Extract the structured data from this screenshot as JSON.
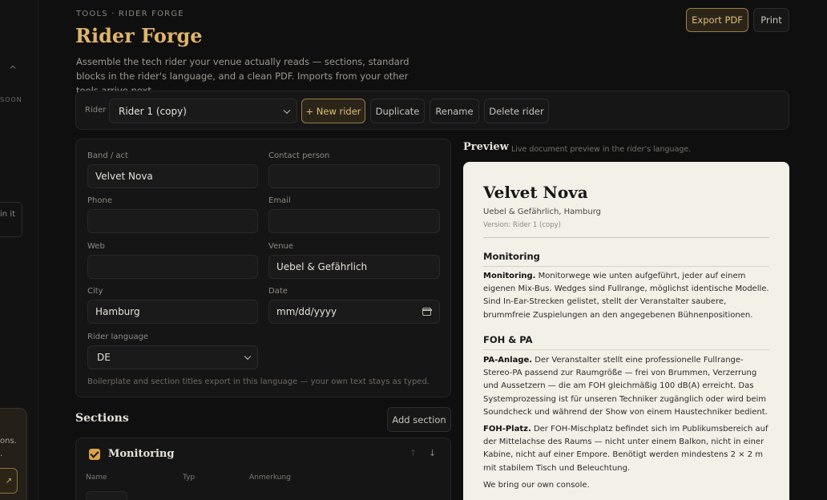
{
  "sidebar": {
    "soon_label": "SOON",
    "join_label": "in it",
    "card_text_1": "ons.",
    "card_text_2": ".",
    "arrow_glyph": "↗"
  },
  "header": {
    "breadcrumb": "TOOLS · RIDER FORGE",
    "title": "Rider Forge",
    "description": "Assemble the tech rider your venue actually reads — sections, standard blocks in the rider's language, and a clean PDF. Imports from your other tools arrive next.",
    "export_label": "Export PDF",
    "print_label": "Print"
  },
  "toolbar": {
    "rider_label": "Rider",
    "rider_selected": "Rider 1 (copy)",
    "new_rider_label": "+ New rider",
    "duplicate_label": "Duplicate",
    "rename_label": "Rename",
    "delete_label": "Delete rider"
  },
  "form": {
    "band_label": "Band / act",
    "band_value": "Velvet Nova",
    "contact_label": "Contact person",
    "contact_value": "",
    "phone_label": "Phone",
    "phone_value": "",
    "email_label": "Email",
    "email_value": "",
    "web_label": "Web",
    "web_value": "",
    "venue_label": "Venue",
    "venue_value": "Uebel & Gefährlich",
    "city_label": "City",
    "city_value": "Hamburg",
    "date_label": "Date",
    "date_placeholder": "mm/dd/yyyy",
    "language_label": "Rider language",
    "language_value": "DE",
    "hint": "Boilerplate and section titles export in this language — your own text stays as typed."
  },
  "sections": {
    "title": "Sections",
    "add_label": "Add section",
    "card": {
      "name": "Monitoring",
      "up_glyph": "↑",
      "down_glyph": "↓",
      "col_name": "Name",
      "col_type": "Typ",
      "col_note": "Anmerkung"
    }
  },
  "preview": {
    "title": "Preview",
    "subtitle": "Live document preview in the rider's language.",
    "band": "Velvet Nova",
    "location": "Uebel & Gefährlich, Hamburg",
    "version": "Version: Rider 1 (copy)",
    "h_monitoring": "Monitoring",
    "p_monitoring_lead": "Monitoring.",
    "p_monitoring_text": " Monitorwege wie unten aufgeführt, jeder auf einem eigenen Mix-Bus. Wedges sind Fullrange, möglichst identische Modelle. Sind In-Ear-Strecken gelistet, stellt der Veranstalter saubere, brummfreie Zuspielungen an den angegebenen Bühnenpositionen.",
    "h_foh": "FOH & PA",
    "p_pa_lead": "PA-Anlage.",
    "p_pa_text": " Der Veranstalter stellt eine professionelle Fullrange-Stereo-PA passend zur Raumgröße — frei von Brummen, Verzerrung und Aussetzern — die am FOH gleichmäßig 100 dB(A) erreicht. Das Systemprozessing ist für unseren Techniker zugänglich oder wird beim Soundcheck und während der Show von einem Haustechniker bedient.",
    "p_fohplatz_lead": "FOH-Platz.",
    "p_fohplatz_text": " Der FOH-Mischplatz befindet sich im Publikumsbereich auf der Mittelachse des Raums — nicht unter einem Balkon, nicht in einer Kabine, nicht auf einer Empore. Benötigt werden mindestens 2 × 2 m mit stabilem Tisch und Beleuchtung.",
    "p_console": "We bring our own console."
  }
}
